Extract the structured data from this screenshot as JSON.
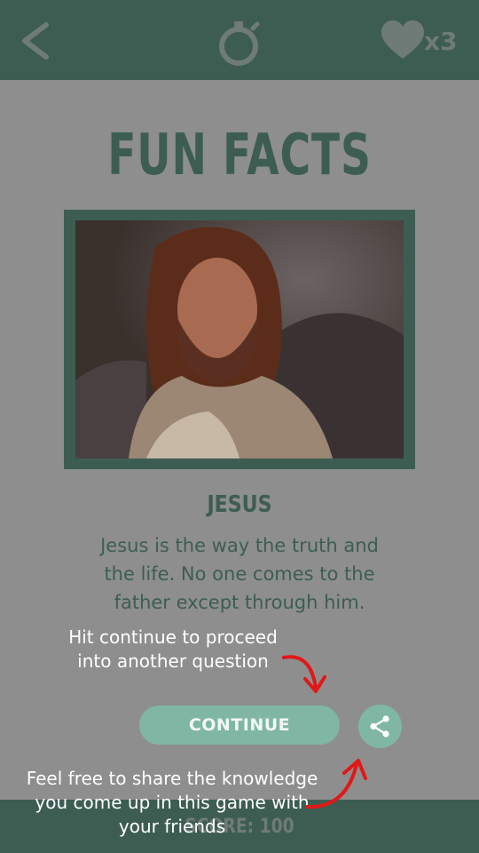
{
  "header": {
    "back_icon": "chevron-left-icon",
    "timer_icon": "stopwatch-icon",
    "lives_icon": "heart-icon",
    "lives_label": "x3"
  },
  "page": {
    "title": "FUN FACTS",
    "fact_name": "JESUS",
    "fact_text": "Jesus is the way the truth and the life. No one comes to the father except through him."
  },
  "actions": {
    "continue_label": "CONTINUE",
    "share_icon": "share-icon"
  },
  "tutorial": {
    "continue_hint": "Hit continue to proceed into another question",
    "share_hint": "Feel free to share the knowledge you come up in this game with your friends"
  },
  "footer": {
    "score_label": "SCORE: 100"
  },
  "colors": {
    "overlay": "#8e8e8e",
    "bar": "#3d5d52",
    "accent": "#7fb7a4",
    "arrow": "#e01818"
  }
}
